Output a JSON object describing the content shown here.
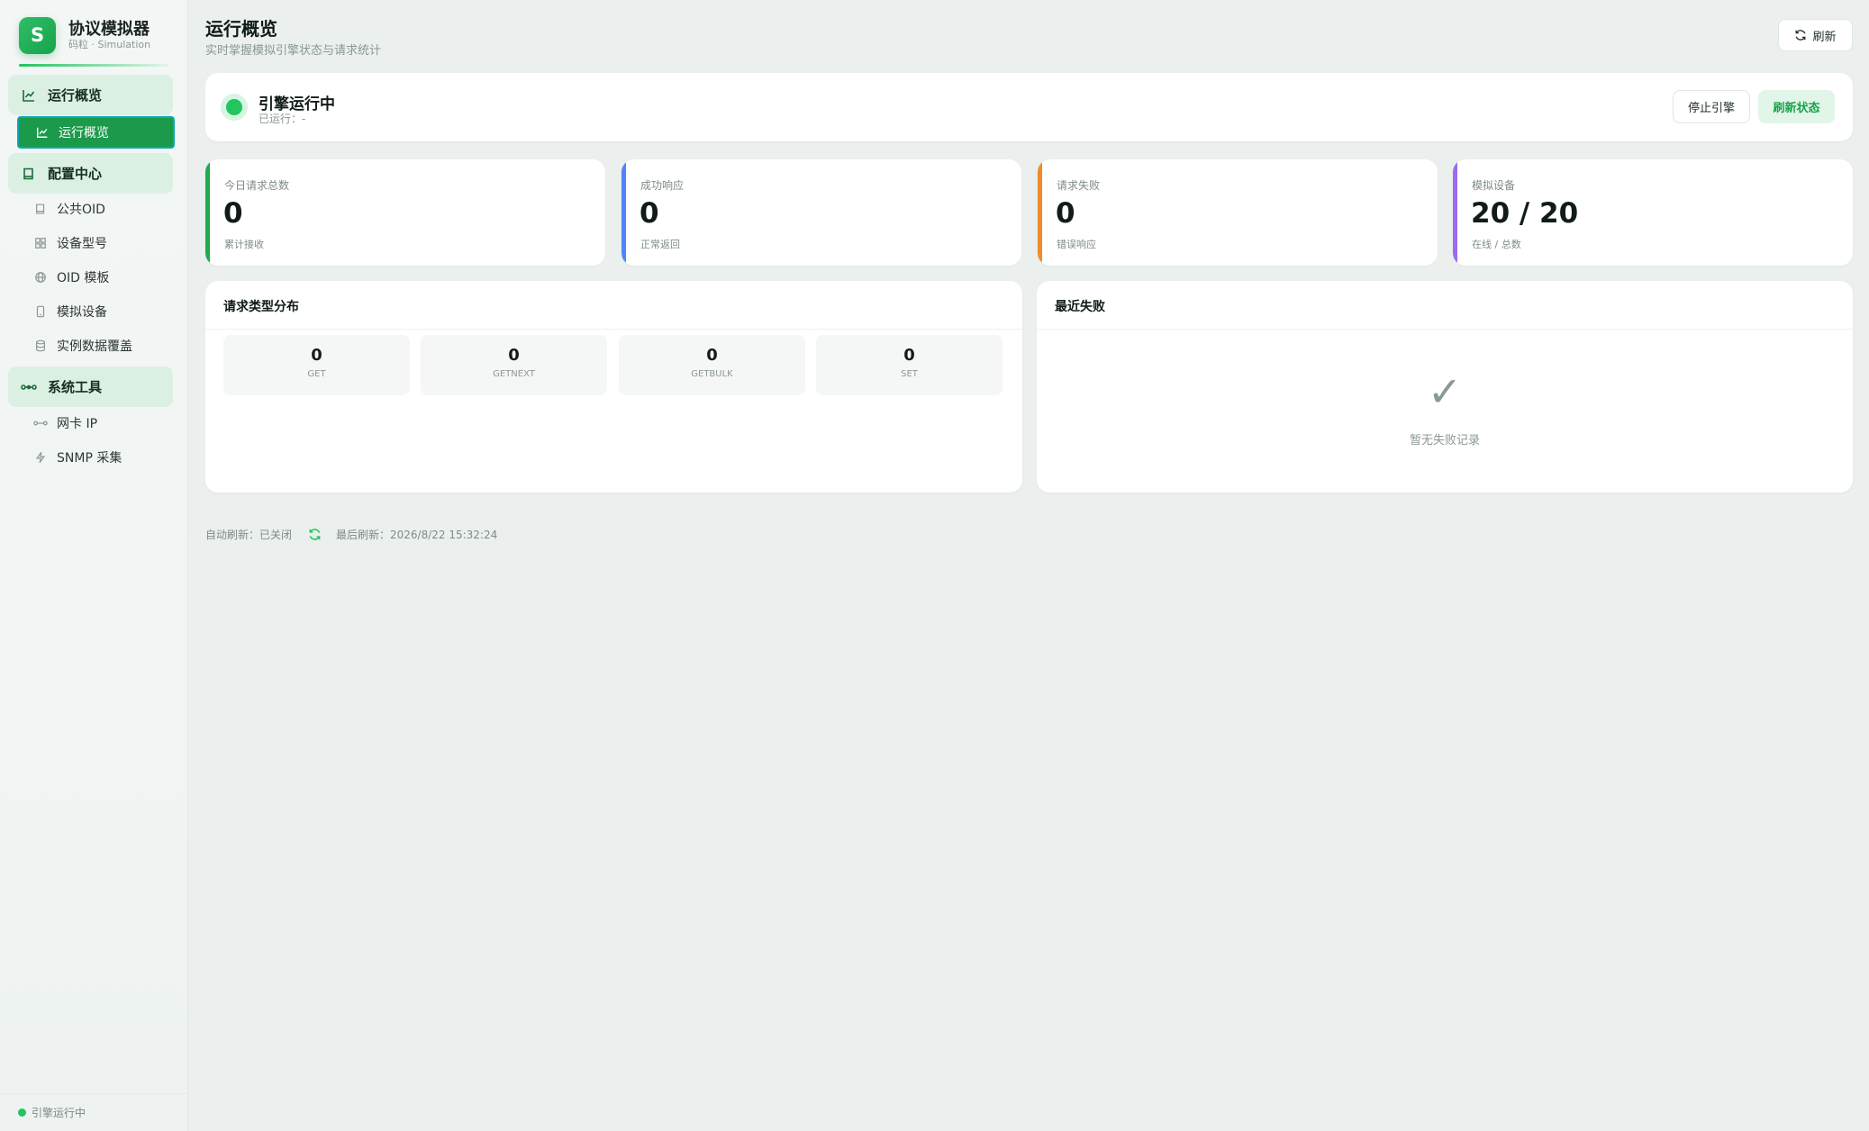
{
  "brand": {
    "logo_letter": "S",
    "title": "协议模拟器",
    "subtitle": "码粒 · Simulation"
  },
  "sidebar": {
    "groups": [
      {
        "label": "运行概览",
        "icon": "line-chart-icon"
      },
      {
        "label": "配置中心",
        "icon": "book-icon"
      },
      {
        "label": "系统工具",
        "icon": "network-icon"
      }
    ],
    "items": [
      {
        "label": "运行概览",
        "icon": "line-chart-icon",
        "active": true
      },
      {
        "label": "公共OID",
        "icon": "book-icon"
      },
      {
        "label": "设备型号",
        "icon": "grid-icon"
      },
      {
        "label": "OID 模板",
        "icon": "globe-icon"
      },
      {
        "label": "模拟设备",
        "icon": "device-icon"
      },
      {
        "label": "实例数据覆盖",
        "icon": "database-icon"
      },
      {
        "label": "网卡 IP",
        "icon": "network-icon"
      },
      {
        "label": "SNMP 采集",
        "icon": "bolt-icon"
      }
    ],
    "footer_status": "引擎运行中"
  },
  "header": {
    "title": "运行概览",
    "subtitle": "实时掌握模拟引擎状态与请求统计",
    "refresh_label": "刷新"
  },
  "engine": {
    "title": "引擎运行中",
    "uptime": "已运行：-",
    "stop_label": "停止引擎",
    "refresh_status_label": "刷新状态",
    "status_color": "#22c55e"
  },
  "stats": [
    {
      "label": "今日请求总数",
      "value": "0",
      "note": "累计接收",
      "color": "#22a94f"
    },
    {
      "label": "成功响应",
      "value": "0",
      "note": "正常返回",
      "color": "#4f86f7"
    },
    {
      "label": "请求失败",
      "value": "0",
      "note": "错误响应",
      "color": "#f28a2c"
    },
    {
      "label": "模拟设备",
      "value": "20 / 20",
      "note": "在线 / 总数",
      "color": "#9b6cf0"
    }
  ],
  "request_types": {
    "title": "请求类型分布",
    "items": [
      {
        "name": "GET",
        "count": "0"
      },
      {
        "name": "GETNEXT",
        "count": "0"
      },
      {
        "name": "GETBULK",
        "count": "0"
      },
      {
        "name": "SET",
        "count": "0"
      }
    ]
  },
  "recent_failures": {
    "title": "最近失败",
    "empty_icon": "check-icon",
    "empty_text": "暂无失败记录"
  },
  "status_bar": {
    "auto_refresh": "自动刷新：已关闭",
    "last_refresh": "最后刷新：2026/8/22 15:32:24"
  }
}
